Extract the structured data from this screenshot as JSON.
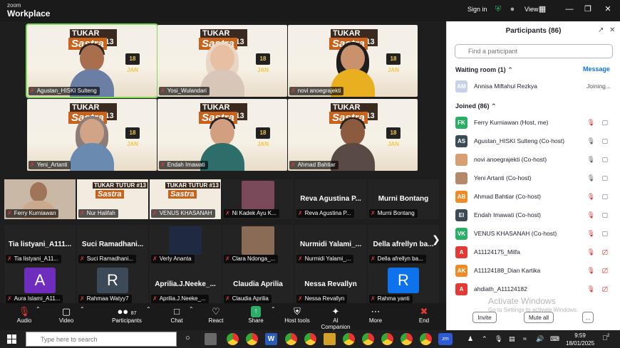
{
  "app": {
    "brand_small": "zoom",
    "brand_big": "Workplace",
    "sign_in": "Sign in",
    "view": "View"
  },
  "gallery": [
    {
      "name": "Agustan_HISKI Sulteng",
      "skin": "#a86e4d",
      "shirt": "#6b7fa5",
      "selected": true
    },
    {
      "name": "Yosi_Wulandari",
      "skin": "#e8bfa2",
      "shirt": "#d8c7b8",
      "hijab": "#e9d6c4"
    },
    {
      "name": "novi anoegrajekti",
      "skin": "#c9916c",
      "shirt": "#e8b020",
      "hijab": "#1e1e1e"
    },
    {
      "name": "Yeni_Artanti",
      "skin": "#d1a487",
      "shirt": "#6a8ab0",
      "hijab": "#8b7d78"
    },
    {
      "name": "Endah Imawati",
      "skin": "#d2a081",
      "shirt": "#2d6d6a"
    },
    {
      "name": "Ahmad Bahtiar",
      "skin": "#8c5b3f",
      "shirt": "#5a4a45"
    }
  ],
  "banner": {
    "title1": "TUKAR TUTUR #13",
    "title2": "Sastra",
    "date": "18 JAN"
  },
  "small_tiles": [
    {
      "name": "Ferry Kurniawan",
      "kind": "video",
      "color": "#caa98e"
    },
    {
      "name": "Nur Halifah",
      "kind": "banner"
    },
    {
      "name": "VENUS KHASANAH",
      "kind": "banner"
    },
    {
      "name": "Ni Kadek Ayu K...",
      "kind": "photo",
      "color": "#7a4a5a"
    },
    {
      "name": "Reva Agustina P...",
      "kind": "label",
      "label": "Reva Agustina P..."
    },
    {
      "name": "Murni Bontang",
      "kind": "label",
      "label": "Murni Bontang"
    },
    {
      "name": "Tia listyani_A11...",
      "kind": "label",
      "label": "Tia listyani_A111..."
    },
    {
      "name": "Suci Ramadhani...",
      "kind": "label",
      "label": "Suci  Ramadhani..."
    },
    {
      "name": "Verly Ananta",
      "kind": "photo",
      "color": "#1f2a40"
    },
    {
      "name": "Clara Ndonga_...",
      "kind": "photo",
      "color": "#8a6b55"
    },
    {
      "name": "Nurmidi Yalami_...",
      "kind": "label",
      "label": "Nurmidi Yalami_..."
    },
    {
      "name": "Della afrellyn ba...",
      "kind": "label",
      "label": "Della afrellyn ba..."
    },
    {
      "name": "Aura Islami_A11...",
      "kind": "avatar",
      "letter": "A",
      "color": "#6f2dbd"
    },
    {
      "name": "Rahmaa Watyy7",
      "kind": "avatar",
      "letter": "R",
      "color": "#3b4a56"
    },
    {
      "name": "Aprilia.J.Neeke_...",
      "kind": "label",
      "label": "Aprilia.J.Neeke_..."
    },
    {
      "name": "Claudia Aprilia",
      "kind": "label",
      "label": "Claudia Aprilia"
    },
    {
      "name": "Nessa Revallyn",
      "kind": "label",
      "label": "Nessa Revallyn"
    },
    {
      "name": "Rahma yanti",
      "kind": "avatar",
      "letter": "R",
      "color": "#0e72ed"
    }
  ],
  "toolbar": {
    "audio": "Audio",
    "video": "Video",
    "participants": "Participants",
    "participants_count": "87",
    "chat": "Chat",
    "react": "React",
    "share": "Share",
    "host_tools": "Host tools",
    "ai_companion": "AI Companion",
    "more": "More",
    "end": "End"
  },
  "panel": {
    "title": "Participants (86)",
    "search_placeholder": "Find a participant",
    "waiting_room": "Waiting room (1)",
    "message": "Message",
    "waiting": [
      {
        "initials": "AM",
        "name": "Annisa Miftahul Rezkya",
        "status": "Joining...",
        "color": "#c7d1e8"
      }
    ],
    "joined_label": "Joined (86)",
    "joined": [
      {
        "initials": "FK",
        "name": "Ferry Kurniawan (Host, me)",
        "color": "#2bae66",
        "mic": "muted",
        "cam": "on"
      },
      {
        "initials": "AS",
        "name": "Agustan_HISKI Sulteng (Co-host)",
        "color": "#3b4a56",
        "mic": "on",
        "cam": "on"
      },
      {
        "initials": "",
        "name": "novi anoegrajekti (Co-host)",
        "color": "#d8a070",
        "mic": "on",
        "cam": "on"
      },
      {
        "initials": "",
        "name": "Yeni Artanti (Co-host)",
        "color": "#b58868",
        "mic": "on",
        "cam": "on"
      },
      {
        "initials": "AB",
        "name": "Ahmad Bahtiar (Co-host)",
        "color": "#f08a24",
        "mic": "muted",
        "cam": "on"
      },
      {
        "initials": "EI",
        "name": "Endah Imawati (Co-host)",
        "color": "#3b4a56",
        "mic": "muted",
        "cam": "on"
      },
      {
        "initials": "VK",
        "name": "VENUS KHASANAH (Co-host)",
        "color": "#2bae66",
        "mic": "muted",
        "cam": "on"
      },
      {
        "initials": "A",
        "name": "A11124175_Milfa",
        "color": "#e53935",
        "mic": "muted",
        "cam": "off"
      },
      {
        "initials": "AK",
        "name": "A11124188_Dian Kartika",
        "color": "#f08a24",
        "mic": "muted",
        "cam": "off"
      },
      {
        "initials": "A",
        "name": "ahdiath_A11124182",
        "color": "#e53935",
        "mic": "muted",
        "cam": "off"
      }
    ],
    "invite": "Invite",
    "mute_all": "Mute all",
    "more": "...",
    "watermark1": "Activate Windows",
    "watermark2": "Go to Settings to activate Windows."
  },
  "taskbar": {
    "search_placeholder": "Type here to search",
    "time": "9:59",
    "date": "18/01/2025",
    "notif": "2"
  }
}
